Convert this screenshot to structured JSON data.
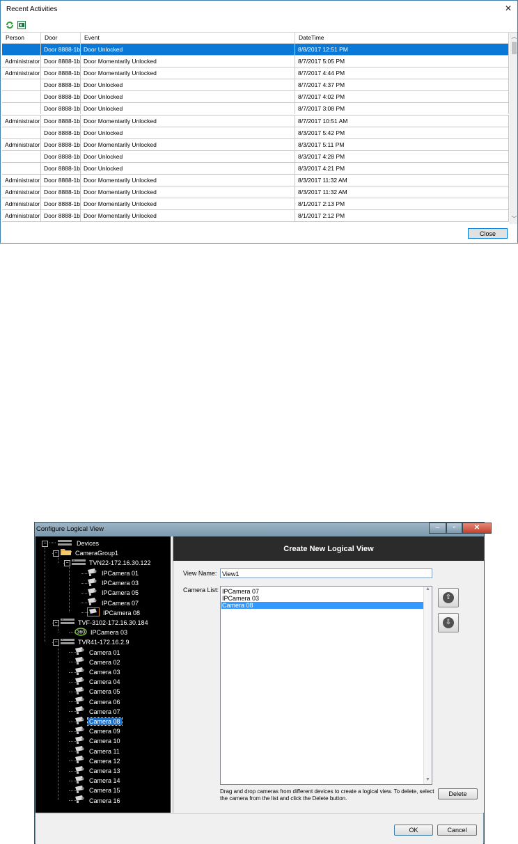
{
  "recent": {
    "title": "Recent Activities",
    "close_x": "✕",
    "columns": [
      "Person",
      "Door",
      "Event",
      "DateTime"
    ],
    "rows": [
      [
        "",
        "Door 8888-1b",
        "Door Unlocked",
        "8/8/2017 12:51 PM"
      ],
      [
        "Administrator",
        "Door 8888-1b",
        "Door Momentarily Unlocked",
        "8/7/2017 5:05 PM"
      ],
      [
        "Administrator",
        "Door 8888-1b",
        "Door Momentarily Unlocked",
        "8/7/2017 4:44 PM"
      ],
      [
        "",
        "Door 8888-1b",
        "Door Unlocked",
        "8/7/2017 4:37 PM"
      ],
      [
        "",
        "Door 8888-1b",
        "Door Unlocked",
        "8/7/2017 4:02 PM"
      ],
      [
        "",
        "Door 8888-1b",
        "Door Unlocked",
        "8/7/2017 3:08 PM"
      ],
      [
        "Administrator",
        "Door 8888-1b",
        "Door Momentarily Unlocked",
        "8/7/2017 10:51 AM"
      ],
      [
        "",
        "Door 8888-1b",
        "Door Unlocked",
        "8/3/2017 5:42 PM"
      ],
      [
        "Administrator",
        "Door 8888-1b",
        "Door Momentarily Unlocked",
        "8/3/2017 5:11 PM"
      ],
      [
        "",
        "Door 8888-1b",
        "Door Unlocked",
        "8/3/2017 4:28 PM"
      ],
      [
        "",
        "Door 8888-1b",
        "Door Unlocked",
        "8/3/2017 4:21 PM"
      ],
      [
        "Administrator",
        "Door 8888-1b",
        "Door Momentarily Unlocked",
        "8/3/2017 11:32 AM"
      ],
      [
        "Administrator",
        "Door 8888-1b",
        "Door Momentarily Unlocked",
        "8/3/2017 11:32 AM"
      ],
      [
        "Administrator",
        "Door 8888-1b",
        "Door Momentarily Unlocked",
        "8/1/2017 2:13 PM"
      ],
      [
        "Administrator",
        "Door 8888-1b",
        "Door Momentarily Unlocked",
        "8/1/2017 2:12 PM"
      ]
    ],
    "selected_row": 0,
    "close_label": "Close",
    "colors": {
      "selection": "#0a78d7",
      "accent": "#3c7fb1"
    }
  },
  "logical": {
    "title": "Configure Logical View",
    "caption_min": "–",
    "caption_max": "▫",
    "caption_close": "✕",
    "header_title": "Create New Logical View",
    "view_name_label": "View Name:",
    "view_name_value": "View1",
    "camera_list_label": "Camera List:",
    "camera_list": [
      "IPCamera 07",
      "IPCamera 03",
      "Camera 08"
    ],
    "camera_list_selected": 2,
    "up_glyph": "⇧",
    "down_glyph": "⇩",
    "hint": "Drag and drop cameras from different devices to create a logical view.  To delete, select the camera from the list and click the Delete button.",
    "delete_label": "Delete",
    "ok_label": "OK",
    "cancel_label": "Cancel",
    "tree": [
      {
        "label": "Devices",
        "level": 0,
        "kind": "root"
      },
      {
        "label": "CameraGroup1",
        "level": 1,
        "kind": "folder"
      },
      {
        "label": "TVN22-172.16.30.122",
        "level": 2,
        "kind": "recorder"
      },
      {
        "label": "IPCamera 01",
        "level": 3,
        "kind": "camera"
      },
      {
        "label": "IPCamera 03",
        "level": 3,
        "kind": "camera"
      },
      {
        "label": "IPCamera 05",
        "level": 3,
        "kind": "camera"
      },
      {
        "label": "IPCamera 07",
        "level": 3,
        "kind": "camera"
      },
      {
        "label": "IPCamera 08",
        "level": 3,
        "kind": "camera-boxed"
      },
      {
        "label": "TVF-3102-172.16.30.184",
        "level": 1,
        "kind": "recorder"
      },
      {
        "label": "IPCamera 03",
        "level": 2,
        "kind": "camera-360"
      },
      {
        "label": "TVR41-172.16.2.9",
        "level": 1,
        "kind": "recorder"
      },
      {
        "label": "Camera 01",
        "level": 2,
        "kind": "camera"
      },
      {
        "label": "Camera 02",
        "level": 2,
        "kind": "camera"
      },
      {
        "label": "Camera 03",
        "level": 2,
        "kind": "camera"
      },
      {
        "label": "Camera 04",
        "level": 2,
        "kind": "camera"
      },
      {
        "label": "Camera 05",
        "level": 2,
        "kind": "camera"
      },
      {
        "label": "Camera 06",
        "level": 2,
        "kind": "camera"
      },
      {
        "label": "Camera 07",
        "level": 2,
        "kind": "camera"
      },
      {
        "label": "Camera 08",
        "level": 2,
        "kind": "camera",
        "selected": true
      },
      {
        "label": "Camera 09",
        "level": 2,
        "kind": "camera"
      },
      {
        "label": "Camera 10",
        "level": 2,
        "kind": "camera"
      },
      {
        "label": "Camera 11",
        "level": 2,
        "kind": "camera"
      },
      {
        "label": "Camera 12",
        "level": 2,
        "kind": "camera"
      },
      {
        "label": "Camera 13",
        "level": 2,
        "kind": "camera"
      },
      {
        "label": "Camera 14",
        "level": 2,
        "kind": "camera"
      },
      {
        "label": "Camera 15",
        "level": 2,
        "kind": "camera"
      },
      {
        "label": "Camera 16",
        "level": 2,
        "kind": "camera"
      }
    ],
    "colors": {
      "tree_bg": "#000000",
      "header_bg": "#2b2b2b",
      "list_selection": "#3399ff"
    }
  }
}
